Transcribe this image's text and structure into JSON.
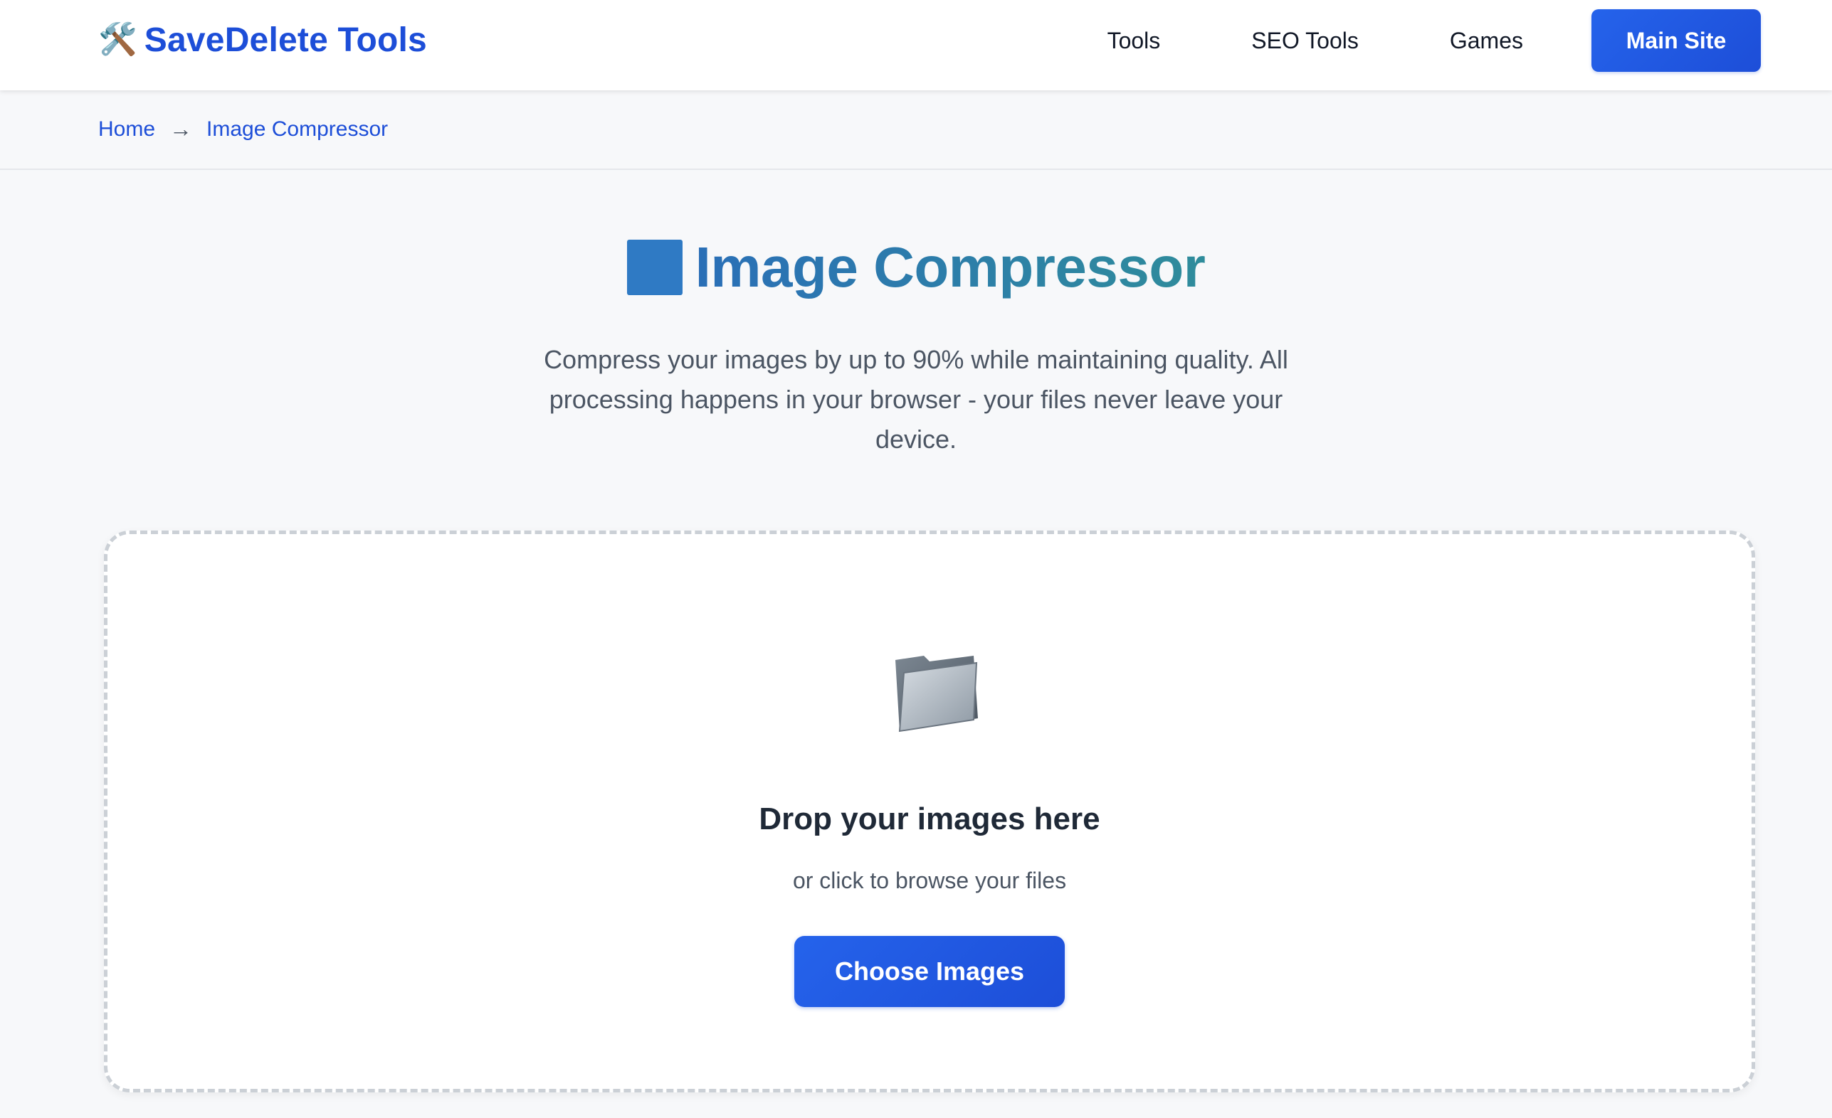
{
  "header": {
    "brand_icon": "🛠️",
    "brand_name": "SaveDelete Tools",
    "nav": [
      "Tools",
      "SEO Tools",
      "Games"
    ],
    "cta_label": "Main Site"
  },
  "breadcrumb": {
    "home": "Home",
    "separator": "→",
    "current": "Image Compressor"
  },
  "hero": {
    "title": "Image Compressor",
    "description": "Compress your images by up to 90% while maintaining quality. All processing happens in your browser - your files never leave your device."
  },
  "dropzone": {
    "icon": "folder-icon",
    "title": "Drop your images here",
    "subtitle": "or click to browse your files",
    "button_label": "Choose Images"
  },
  "colors": {
    "brand": "#1d4ed8",
    "title_gradient_start": "#2a6fb7",
    "title_gradient_end": "#2f8c9b",
    "background": "#f7f8fa"
  }
}
